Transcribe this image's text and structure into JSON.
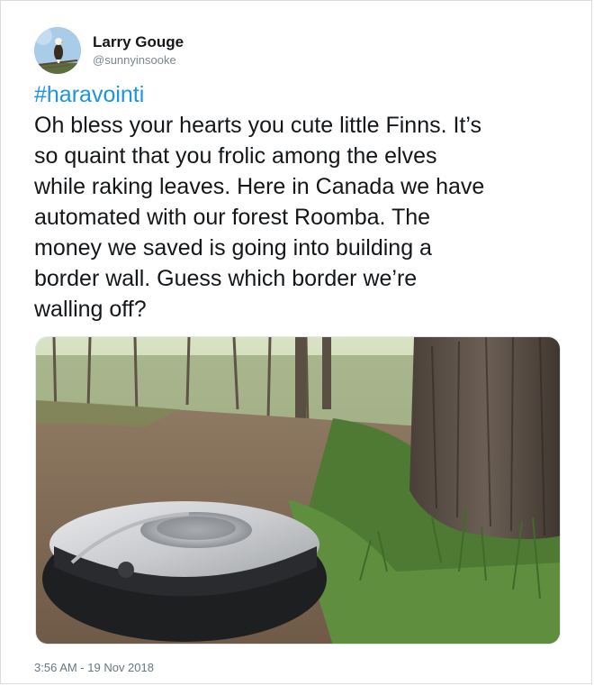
{
  "tweet": {
    "display_name": "Larry Gouge",
    "handle": "@sunnyinsooke",
    "hashtag": "#haravointi",
    "text_lines": [
      "Oh bless your hearts you cute little Finns. It’s",
      "so quaint that you frolic among the elves",
      "while raking leaves. Here in Canada we have",
      "automated with our forest Roomba. The",
      "money we saved is going into building a",
      "border wall. Guess which border we’re",
      "walling off?"
    ],
    "timestamp": "3:56 AM - 19 Nov 2018"
  },
  "avatar": {
    "icon": "eagle-on-branch-icon",
    "sky_color": "#a9cce8"
  },
  "photo": {
    "subject": "forest-roomba-photo"
  },
  "colors": {
    "hashtag": "#1b95e0",
    "text": "#14171a",
    "meta": "#657786"
  }
}
